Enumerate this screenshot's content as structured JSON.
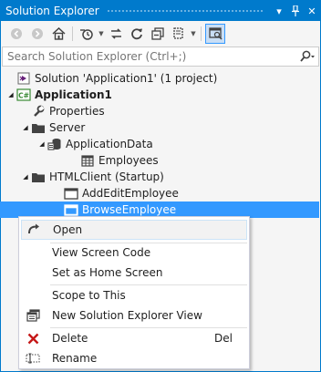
{
  "window": {
    "title": "Solution Explorer"
  },
  "search": {
    "placeholder": "Search Solution Explorer (Ctrl+;)"
  },
  "tree": [
    {
      "label": "Solution 'Application1' (1 project)",
      "icon": "solution-icon",
      "bold": false,
      "expander": ""
    },
    {
      "label": "Application1",
      "icon": "csharp-project-icon",
      "bold": true,
      "expander": "expanded"
    },
    {
      "label": "Properties",
      "icon": "wrench-icon",
      "bold": false,
      "expander": ""
    },
    {
      "label": "Server",
      "icon": "folder-icon",
      "bold": false,
      "expander": "expanded"
    },
    {
      "label": "ApplicationData",
      "icon": "database-icon",
      "bold": false,
      "expander": "expanded"
    },
    {
      "label": "Employees",
      "icon": "table-icon",
      "bold": false,
      "expander": ""
    },
    {
      "label": "HTMLClient (Startup)",
      "icon": "folder-icon",
      "bold": false,
      "expander": "expanded"
    },
    {
      "label": "AddEditEmployee",
      "icon": "screen-icon",
      "bold": false,
      "expander": ""
    },
    {
      "label": "BrowseEmployee",
      "icon": "screen-icon",
      "bold": false,
      "expander": "",
      "selected": true
    }
  ],
  "context_menu": {
    "open": "Open",
    "view_screen_code": "View Screen Code",
    "set_as_home": "Set as Home Screen",
    "scope_to_this": "Scope to This",
    "new_view": "New Solution Explorer View",
    "delete": "Delete",
    "delete_shortcut": "Del",
    "rename": "Rename"
  },
  "colors": {
    "accent": "#007acc",
    "selection": "#3399ff",
    "delete_red": "#c51717"
  }
}
